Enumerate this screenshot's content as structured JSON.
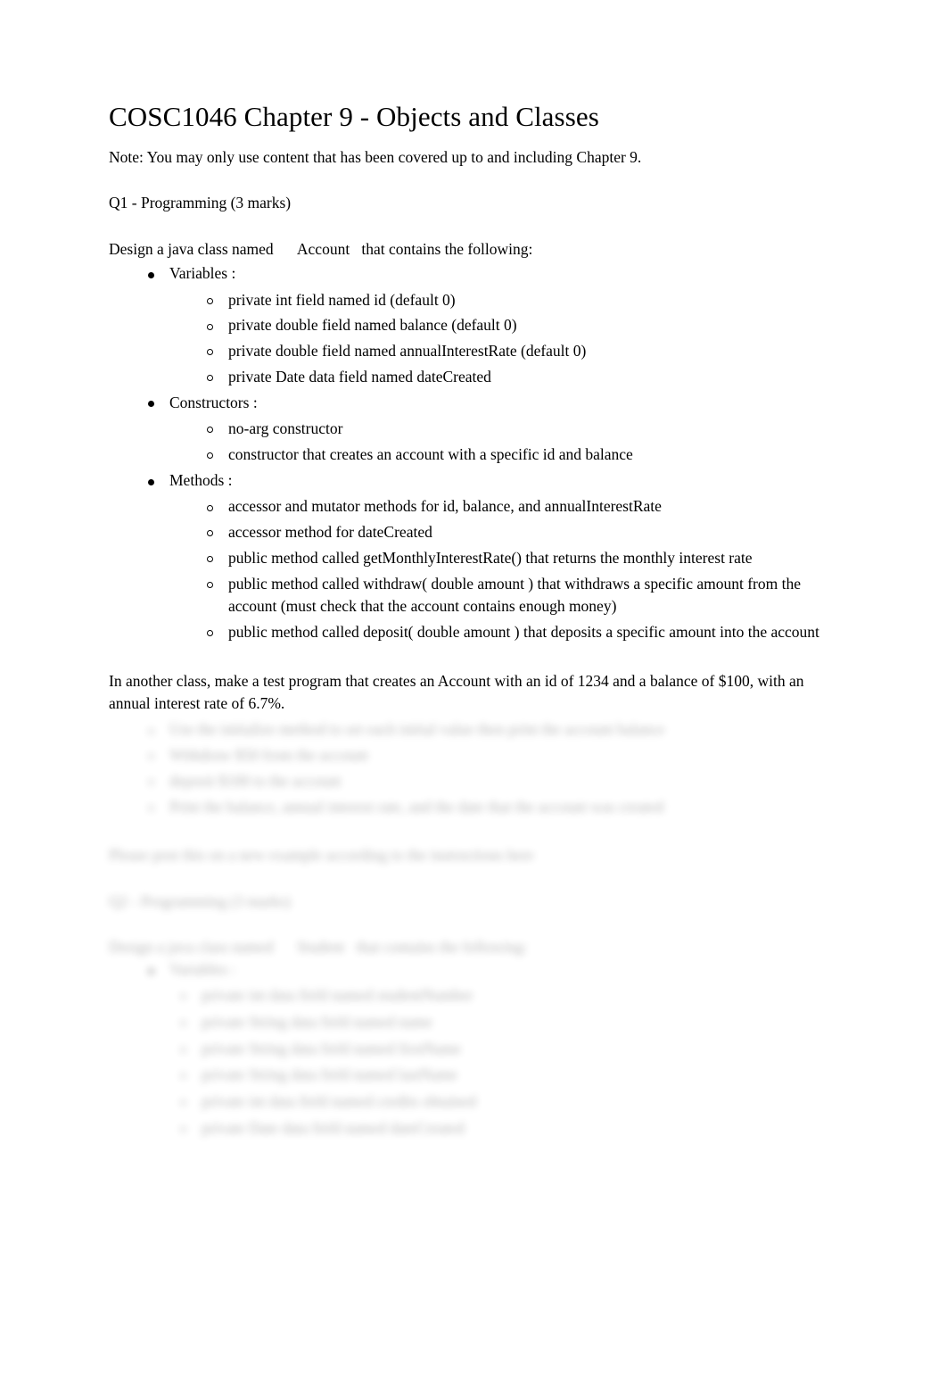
{
  "document": {
    "title": "COSC1046 Chapter 9 - Objects and Classes",
    "note": "Note: You may only use content that has been covered up to and including Chapter 9.",
    "q1_heading": "Q1 - Programming (3 marks)",
    "q1_intro_before": "Design a java class named",
    "q1_intro_code": "Account",
    "q1_intro_after": "that contains the following:",
    "sections": [
      {
        "label": "Variables  :",
        "items": [
          "private int field named id (default 0)",
          "private double field named balance (default 0)",
          "private double field named annualInterestRate (default 0)",
          "private Date data field named dateCreated"
        ]
      },
      {
        "label": "Constructors  :",
        "items": [
          "no-arg constructor",
          "constructor that creates an account with a specific id and balance"
        ]
      },
      {
        "label": "Methods :",
        "items": [
          "accessor and mutator methods for id, balance, and annualInterestRate",
          "accessor method for dateCreated",
          "public method called getMonthlyInterestRate() that returns the monthly interest rate",
          "public method called withdraw(   double amount  ) that withdraws a specific amount from the account (must check that the account contains enough money)",
          "public method called deposit(    double amount  ) that deposits a specific amount into the account"
        ]
      }
    ],
    "q1_test_paragraph": "In another class, make a test program that creates an Account with an id of 1234 and a balance of $100, with an annual interest rate of 6.7%.",
    "obscured_region": {
      "is_blurred": true,
      "description": "remainder of document is blurred / obscured preview",
      "lines_group_1": [
        "Use the initialize method to set each initial value then print the account balance",
        "Withdraw $50 from the account",
        "deposit $100 to the account",
        "Print the balance, annual interest rate, and the date that the account was created"
      ],
      "line_after_group_1": "Please post this on a new example according to the instructions here",
      "q2_heading": "Q2 - Programming (3 marks)",
      "q2_intro_before": "Design a java class named",
      "q2_intro_code": "Student",
      "q2_intro_after": "that contains the following:",
      "q2_section_label": "Variables :",
      "q2_items": [
        "private int data field named studentNumber",
        "private String data field named name",
        "private String data field named firstName",
        "private String data field named lastName",
        "private int data field named credits obtained",
        "private Date data field named dateCreated"
      ]
    }
  }
}
